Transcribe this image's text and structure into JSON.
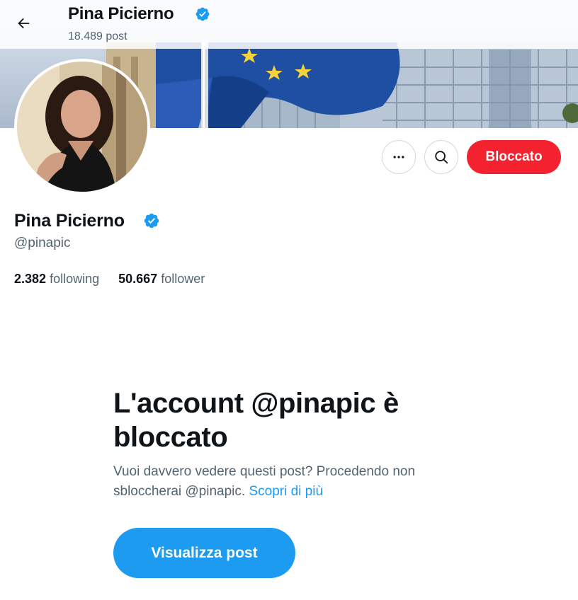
{
  "header": {
    "back_icon": "arrow-left-icon",
    "name": "Pina Picierno",
    "post_count": "18.489 post"
  },
  "profile": {
    "name": "Pina Picierno",
    "verified_icon": "verified-badge-icon",
    "handle": "@pinapic",
    "following_count": "2.382",
    "following_label": "following",
    "follower_count": "50.667",
    "follower_label": "follower"
  },
  "actions": {
    "more_icon": "more-icon",
    "search_icon": "search-icon",
    "blocked_label": "Bloccato"
  },
  "blocked_notice": {
    "title": "L'account @pinapic è bloccato",
    "text": "Vuoi davvero vedere questi post? Procedendo non sbloccherai @pinapic.",
    "learn_more": "Scopri di più",
    "view_button": "Visualizza post"
  },
  "colors": {
    "accent": "#1d9bf0",
    "blocked_red": "#f4212e",
    "verified_blue": "#1d9bf0",
    "secondary_text": "#536471",
    "primary_text": "#0f1419"
  }
}
